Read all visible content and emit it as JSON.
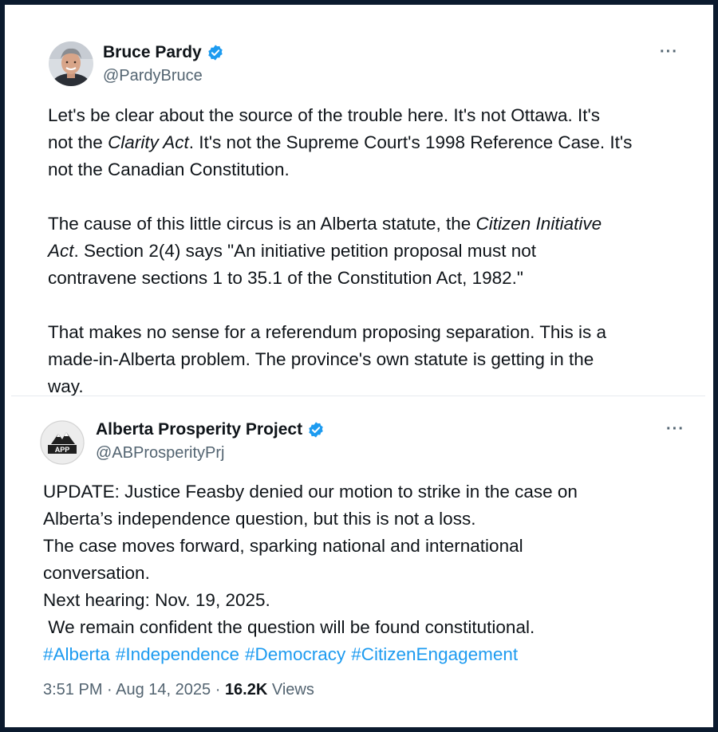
{
  "tweet1": {
    "name": "Bruce Pardy",
    "handle": "@PardyBruce",
    "more": "···",
    "para1": {
      "l1": "Let's be clear about the source of the trouble here. It's not Ottawa. It's",
      "l2_pre": "not the ",
      "l2_italic": "Clarity Act",
      "l2_post": ". It's not the Supreme Court's 1998 Reference Case. It's",
      "l3": "not the Canadian Constitution."
    },
    "para2": {
      "l1_pre": "The cause of this little circus is an Alberta statute, the ",
      "l1_italic": "Citizen Initiative",
      "l2_italic": "Act",
      "l2_post": ". Section 2(4) says \"An initiative petition proposal must not",
      "l3": "contravene sections 1 to 35.1 of the Constitution Act, 1982.\""
    },
    "para3": {
      "l1": "That makes no sense for a referendum proposing separation. This is a",
      "l2": "made-in-Alberta problem. The province's own statute is getting in the",
      "l3": "way."
    }
  },
  "tweet2": {
    "name": "Alberta Prosperity Project",
    "handle": "@ABProsperityPrj",
    "more": "···",
    "avatar_text": "APP",
    "lines": [
      "UPDATE: Justice Feasby denied our motion to strike in the case on",
      "Alberta’s independence question, but this is not a loss.",
      "The case moves forward, sparking national and international",
      "conversation.",
      "Next hearing: Nov. 19, 2025.",
      " We remain confident the question will be found constitutional."
    ],
    "hashtags": [
      "#Alberta",
      "#Independence",
      "#Democracy",
      "#CitizenEngagement"
    ],
    "time": "3:51 PM",
    "sep1": " · ",
    "date": "Aug 14, 2025",
    "sep2": " · ",
    "views_count": "16.2K",
    "views_label": " Views"
  },
  "colors": {
    "link": "#1d9bf0",
    "verified": "#1d9bf0",
    "secondary_text": "#536471",
    "frame": "#0b1a2e"
  },
  "icons": {
    "verified": "verified-badge-icon",
    "more": "more-options-icon"
  }
}
